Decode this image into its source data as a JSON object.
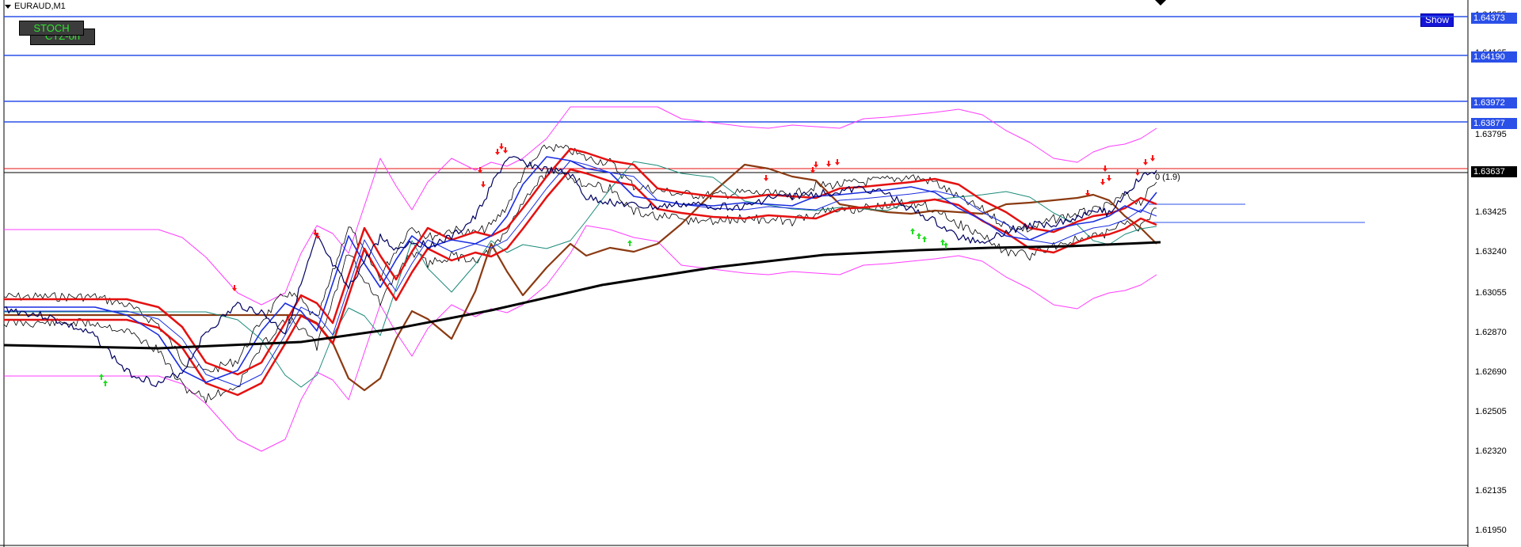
{
  "window": {
    "title": "EURAUD,M1"
  },
  "buttons": {
    "stoch": "STOCH",
    "ctz": "CTZ-on",
    "show": "Show"
  },
  "price_axis": {
    "ticks": [
      "1.64355",
      "1.64165",
      "1.63795",
      "1.63610",
      "1.63425",
      "1.63240",
      "1.63055",
      "1.62870",
      "1.62690",
      "1.62505",
      "1.62320",
      "1.62135",
      "1.61950"
    ],
    "highlight_labels": [
      {
        "label": "1.64373",
        "style": "blue"
      },
      {
        "label": "1.64190",
        "style": "blue"
      },
      {
        "label": "1.63972",
        "style": "blue"
      },
      {
        "label": "1.63877",
        "style": "blue"
      },
      {
        "label": "1.63637",
        "style": "black"
      }
    ]
  },
  "annotations": {
    "ratio_text": "0 (1.9)"
  },
  "colors": {
    "price_line": "#000060",
    "ma_red": "#e51010",
    "ma_blue": "#1a2ee0",
    "ma_brown": "#8b3a12",
    "ma_black": "#000000",
    "bands_magenta": "#ff3cff",
    "arrow_up": "#22dd22",
    "arrow_down": "#ff1010",
    "hline_blue": "#2b50e8",
    "hline_red": "#e51010"
  }
}
